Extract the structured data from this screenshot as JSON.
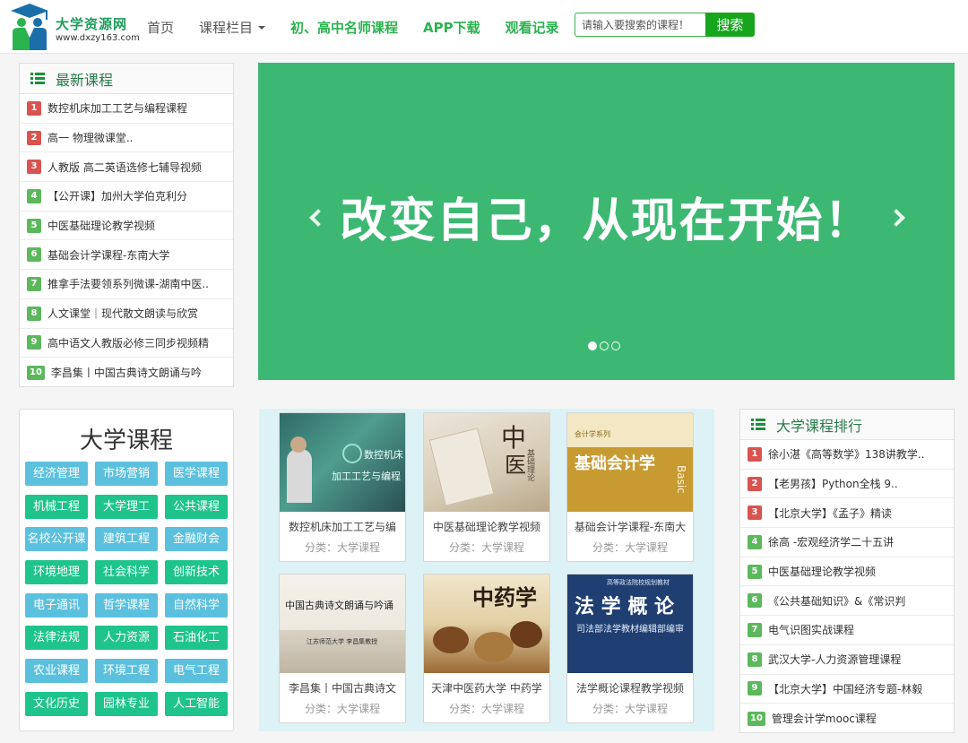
{
  "header": {
    "logo_title": "大学资源网",
    "logo_url": "www.dxzy163.com",
    "nav": [
      {
        "label": "首页"
      },
      {
        "label": "课程栏目"
      },
      {
        "label": "初、高中名师课程"
      },
      {
        "label": "APP下载"
      },
      {
        "label": "观看记录"
      }
    ],
    "search_placeholder": "请输入要搜索的课程！",
    "search_button": "搜索",
    "brand_color": "#17a51d"
  },
  "latest": {
    "title": "最新课程",
    "items": [
      {
        "num": "1",
        "text": "数控机床加工工艺与编程课程"
      },
      {
        "num": "2",
        "text": "高一 物理微课堂.."
      },
      {
        "num": "3",
        "text": "人教版 高二英语选修七辅导视频"
      },
      {
        "num": "4",
        "text": "【公开课】加州大学伯克利分"
      },
      {
        "num": "5",
        "text": "中医基础理论教学视频"
      },
      {
        "num": "6",
        "text": "基础会计学课程-东南大学"
      },
      {
        "num": "7",
        "text": "推拿手法要领系列微课-湖南中医.."
      },
      {
        "num": "8",
        "text": "人文课堂｜现代散文朗读与欣赏"
      },
      {
        "num": "9",
        "text": "高中语文人教版必修三同步视频精"
      },
      {
        "num": "10",
        "text": "李昌集丨中国古典诗文朗诵与吟"
      }
    ]
  },
  "banner": {
    "text": "改变自己，从现在开始！",
    "color": "#3cb872",
    "slide_count": 3,
    "active_slide": 1
  },
  "categories": {
    "title": "大学课程",
    "items": [
      "经济管理",
      "市场营销",
      "医学课程",
      "机械工程",
      "大学理工",
      "公共课程",
      "名校公开课",
      "建筑工程",
      "金融财会",
      "环境地理",
      "社会科学",
      "创新技术",
      "电子通讯",
      "哲学课程",
      "自然科学",
      "法律法规",
      "人力资源",
      "石油化工",
      "农业课程",
      "环境工程",
      "电气工程",
      "文化历史",
      "园林专业",
      "人工智能"
    ]
  },
  "courses": {
    "items": [
      {
        "title": "数控机床加工工艺与编",
        "category": "分类：大学课程",
        "thumb_lines": [
          "数控机床",
          "加工工艺与编程"
        ]
      },
      {
        "title": "中医基础理论教学视频",
        "category": "分类：大学课程",
        "thumb_lines": [
          "中",
          "医",
          "基础理论"
        ]
      },
      {
        "title": "基础会计学课程-东南大",
        "category": "分类：大学课程",
        "thumb_lines": [
          "会计学系列",
          "基础会计学",
          "Basic"
        ]
      },
      {
        "title": "李昌集丨中国古典诗文",
        "category": "分类：大学课程",
        "thumb_lines": [
          "中国古典诗文朗诵与吟诵",
          "江苏师范大学 李昌集教授"
        ]
      },
      {
        "title": "天津中医药大学 中药学",
        "category": "分类：大学课程",
        "thumb_lines": [
          "中药学"
        ]
      },
      {
        "title": "法学概论课程教学视频",
        "category": "分类：大学课程",
        "thumb_lines": [
          "高等政法院校规划教材",
          "法 学 概 论",
          "司法部法学教材编辑部编审"
        ]
      }
    ]
  },
  "ranking": {
    "title": "大学课程排行",
    "items": [
      {
        "num": "1",
        "text": "徐小湛《高等数学》138讲教学.."
      },
      {
        "num": "2",
        "text": "【老男孩】Python全栈 9.."
      },
      {
        "num": "3",
        "text": "【北京大学】《孟子》精读"
      },
      {
        "num": "4",
        "text": "徐高 -宏观经济学二十五讲"
      },
      {
        "num": "5",
        "text": "中医基础理论教学视频"
      },
      {
        "num": "6",
        "text": "《公共基础知识》&《常识判"
      },
      {
        "num": "7",
        "text": "电气识图实战课程"
      },
      {
        "num": "8",
        "text": "武汉大学-人力资源管理课程"
      },
      {
        "num": "9",
        "text": "【北京大学】中国经济专题-林毅"
      },
      {
        "num": "10",
        "text": "管理会计学mooc课程"
      }
    ]
  }
}
